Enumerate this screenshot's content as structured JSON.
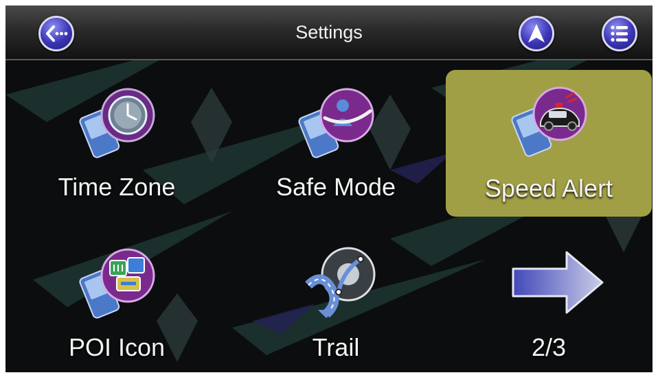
{
  "header": {
    "title": "Settings",
    "back_icon": "back-arrow-icon",
    "navigation_icon": "navigation-arrow-icon",
    "menu_icon": "list-menu-icon"
  },
  "tiles": [
    {
      "label": "Time Zone",
      "icon": "time-zone-icon",
      "selected": false
    },
    {
      "label": "Safe Mode",
      "icon": "safe-mode-icon",
      "selected": false
    },
    {
      "label": "Speed Alert",
      "icon": "speed-alert-icon",
      "selected": true
    },
    {
      "label": "POI Icon",
      "icon": "poi-icon",
      "selected": false
    },
    {
      "label": "Trail",
      "icon": "trail-icon",
      "selected": false
    }
  ],
  "pager": {
    "label": "2/3",
    "icon": "next-page-arrow-icon"
  },
  "colors": {
    "selected_tile": "#a19f45",
    "button_purple": "#3b34b6",
    "icon_purple": "#7a2a8c",
    "text": "#f4f4f4"
  }
}
